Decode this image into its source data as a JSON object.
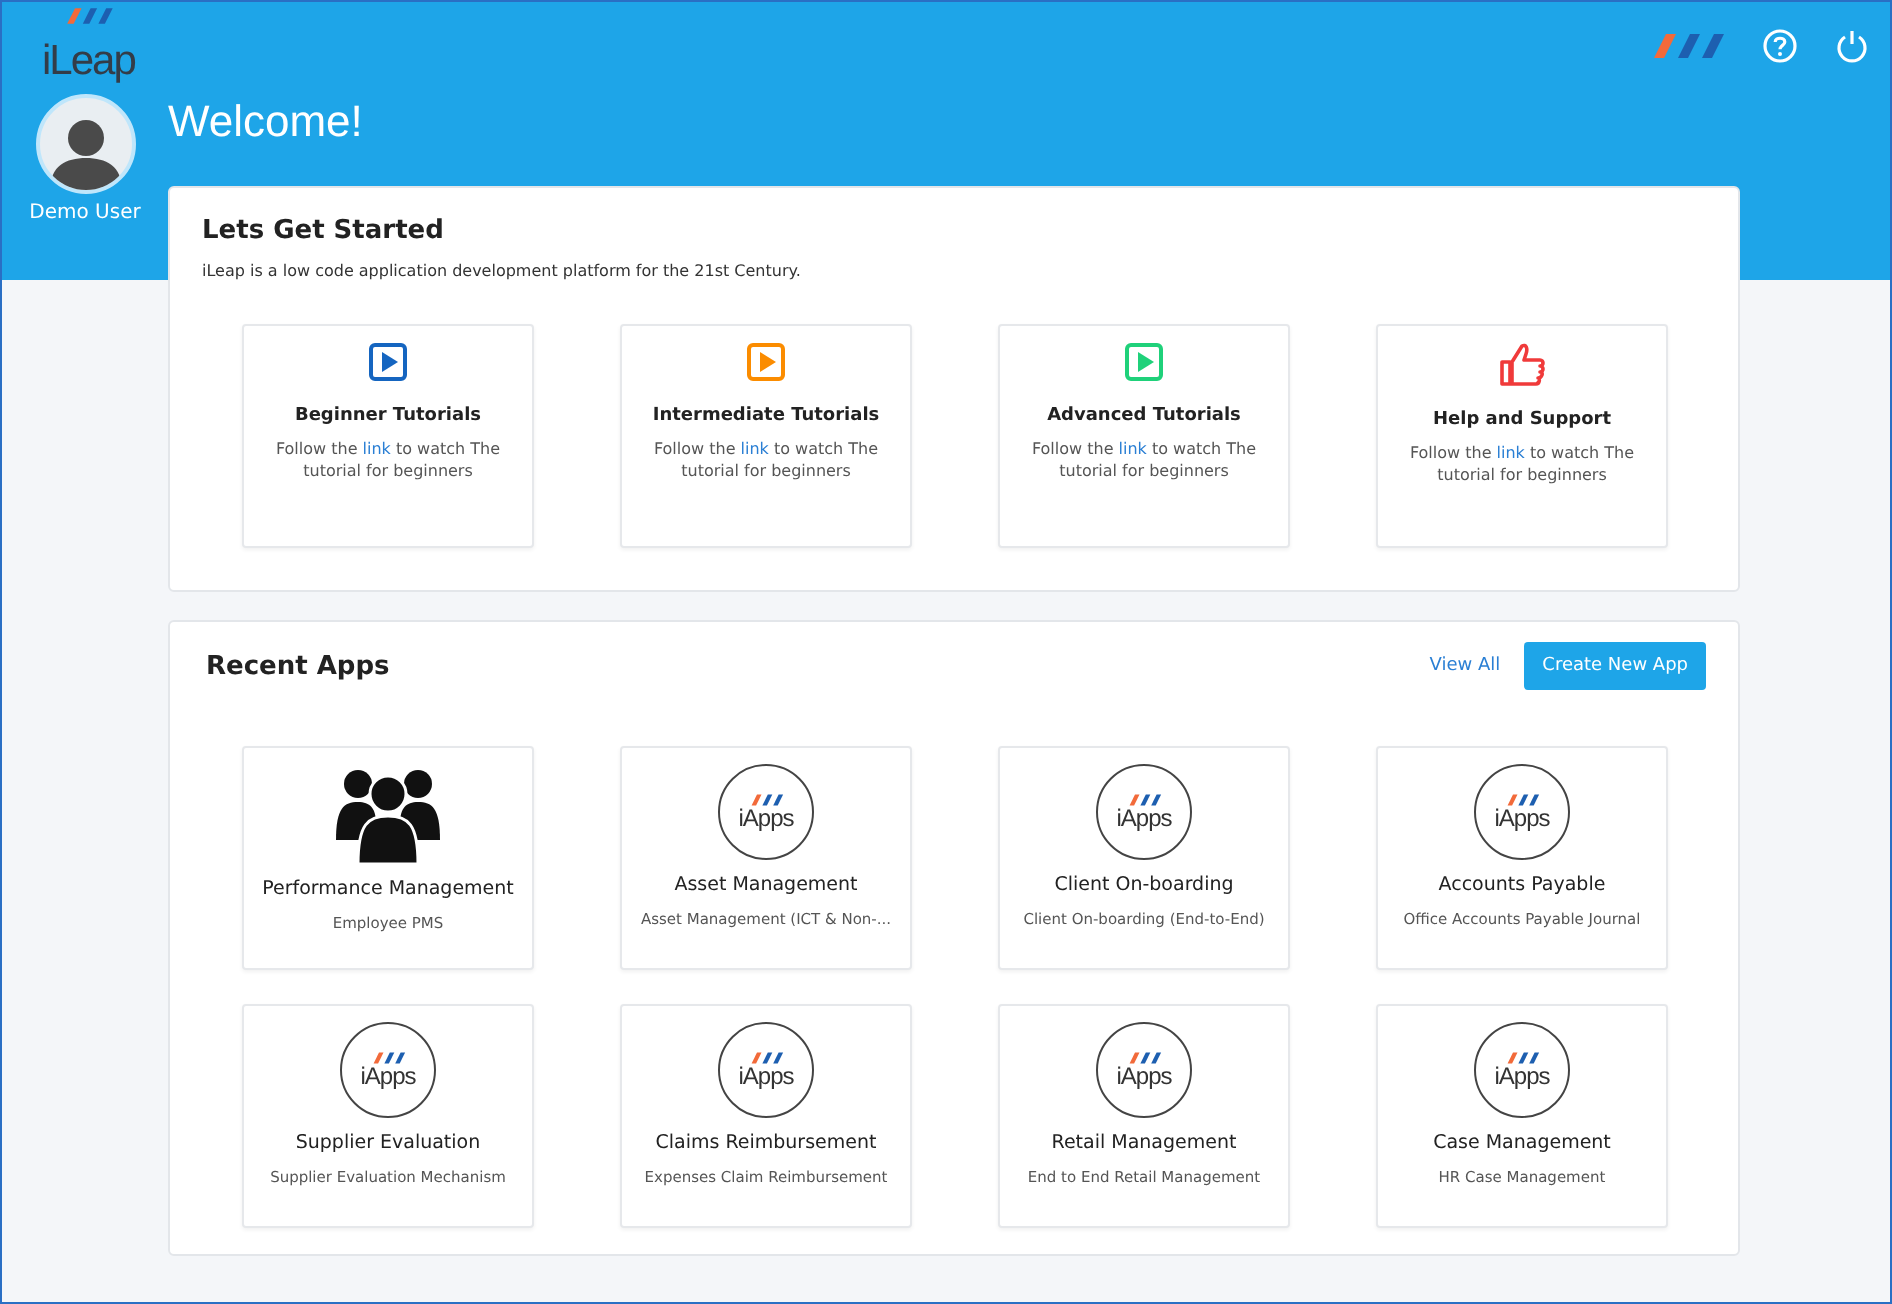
{
  "header": {
    "logo": "iLeap",
    "user": "Demo User",
    "welcome": "Welcome!"
  },
  "started": {
    "title": "Lets Get Started",
    "intro": "iLeap is a low code application development platform for the 21st Century.",
    "cards": [
      {
        "kind": "play",
        "color": "#1565c0",
        "title": "Beginner Tutorials",
        "before": "Follow the",
        "link": "link",
        "after": "to watch The tutorial for beginners"
      },
      {
        "kind": "play",
        "color": "#fb8c00",
        "title": "Intermediate Tutorials",
        "before": "Follow the",
        "link": "link",
        "after": "to watch The tutorial for beginners"
      },
      {
        "kind": "play",
        "color": "#1fd17a",
        "title": "Advanced Tutorials",
        "before": "Follow the",
        "link": "link",
        "after": "to watch The tutorial for beginners"
      },
      {
        "kind": "thumb",
        "color": "#f03a3a",
        "title": "Help and Support",
        "before": "Follow the",
        "link": "link",
        "after": "to watch The tutorial for beginners"
      }
    ]
  },
  "recent": {
    "title": "Recent Apps",
    "view_all": "View All",
    "create": "Create New App",
    "apps": [
      {
        "kind": "people",
        "name": "Performance Management",
        "desc": "Employee PMS"
      },
      {
        "kind": "iapps",
        "logo": "iApps",
        "name": "Asset Management",
        "desc": "Asset Management (ICT & Non-..."
      },
      {
        "kind": "iapps",
        "logo": "iApps",
        "name": "Client On-boarding",
        "desc": "Client On-boarding (End-to-End)"
      },
      {
        "kind": "iapps",
        "logo": "iApps",
        "name": "Accounts Payable",
        "desc": "Office Accounts Payable Journal"
      },
      {
        "kind": "iapps",
        "logo": "iApps",
        "name": "Supplier Evaluation",
        "desc": "Supplier Evaluation Mechanism"
      },
      {
        "kind": "iapps",
        "logo": "iApps",
        "name": "Claims Reimbursement",
        "desc": "Expenses Claim Reimbursement"
      },
      {
        "kind": "iapps",
        "logo": "iApps",
        "name": "Retail Management",
        "desc": "End to End Retail Management"
      },
      {
        "kind": "iapps",
        "logo": "iApps",
        "name": "Case Management",
        "desc": "HR Case Management"
      }
    ]
  }
}
